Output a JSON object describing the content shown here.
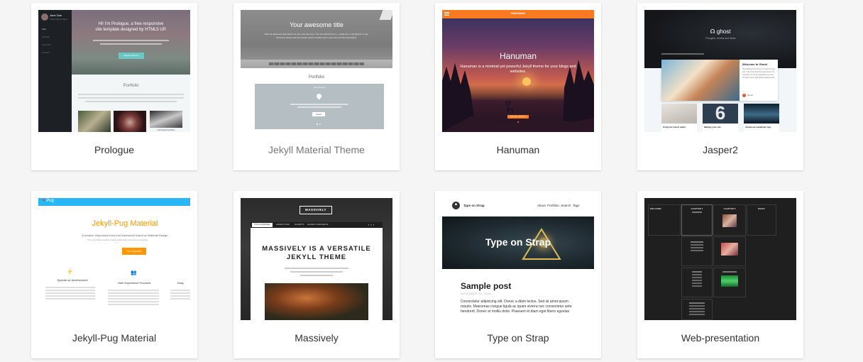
{
  "themes": [
    {
      "title": "Prologue",
      "preview": {
        "sidebar_name": "Jane Doe",
        "sidebar_sub": "Lorem ipsum dolor",
        "nav": [
          "Intro",
          "Portfolio",
          "About Me",
          "Contact"
        ],
        "hero_text_1": "Hi! I'm Prologue, a free responsive",
        "hero_text_2": "site template designed by HTML5 UP.",
        "hero_button": "Magna Aliquam",
        "section_title": "Portfolio",
        "caption": "Nisl ligula faucibus"
      }
    },
    {
      "title": "Jekyll Material Theme",
      "preview": {
        "heading": "Your awesome title",
        "desc_1": "Write an awesome description for your new site here. You can edit this line in _config.yml. It will appear in your",
        "desc_2": "document head meta (for Google search results) and in your feed.xml site description.",
        "section_title": "Portfolio",
        "card_title": "Post Project",
        "card_button": "Read"
      }
    },
    {
      "title": "Hanuman",
      "preview": {
        "brand": "HANUMAN",
        "heading": "Hanuman",
        "desc_1": "Hanuman is a minimal yet powerful Jekyll theme for your blogs and",
        "desc_2": "websites.",
        "button": "READ MORE"
      }
    },
    {
      "title": "Jasper2",
      "preview": {
        "brand": "ghost",
        "tagline": "Thoughts, stories and ideas",
        "post_title": "Welcome to Ghost",
        "post_text": "Hey! Welcome to Ghost, it's great to have you :) We know that first impressions are important, so we've populated your new site with some initial getting started posts",
        "post_author": "Ghost",
        "big_number": "6",
        "card_1": "Using the Ghost editor",
        "card_2": "Making your site",
        "card_3": "Advanced markdown tips"
      }
    },
    {
      "title": "Jekyll-Pug Material",
      "preview": {
        "nav_text": "Pug",
        "heading": "Jekyll-Pug Material",
        "subheading": "A modern responsive front-end framework based on Material Design",
        "small": "This is a template, originally created by Materialize, ported over to Jekyll-Pug.",
        "button": "GET STARTED",
        "features": [
          "Speeds up development",
          "User Experience Focused",
          "Easy"
        ]
      }
    },
    {
      "title": "Massively",
      "preview": {
        "logo": "MASSIVELY",
        "nav": [
          "THIS IS MASSIVELY",
          "GENERIC PAGE",
          "ELEMENTS",
          "ELEMENTS REFERENCE"
        ],
        "heading_1": "MASSIVELY IS A VERSATILE",
        "heading_2": "JEKYLL THEME"
      }
    },
    {
      "title": "Type on Strap",
      "preview": {
        "brand": "Type on Strap",
        "nav": "About  Portfolio  Search  Tags",
        "hero_text": "Type on Strap",
        "post_title": "Sample post",
        "post_date": "NOVEMBER 30, 2016",
        "body_1": "Consectetur adipiscing elit. Donec a diam lectus. Sed sit amet ipsum",
        "body_2": "mauris. Maecenas congue ligula ac quam viverra nec consectetur ante",
        "body_3": "hendrerit. Donec et mollis dolor. Praesent et diam eget libero egestas"
      }
    },
    {
      "title": "Web-presentation",
      "preview": {
        "col_headers": [
          "WELCOME",
          "CHAPTER 1",
          "CHAPTER 2",
          "ENJOY"
        ]
      }
    }
  ],
  "colors": {
    "page_bg": "#f5f5f5",
    "card_bg": "#ffffff",
    "title_text": "#333333",
    "title_text_muted": "#777777",
    "hanuman_orange": "#f97a20",
    "pug_blue": "#29b6f6",
    "pug_orange": "#ff9800",
    "massively_dark": "#242424"
  }
}
